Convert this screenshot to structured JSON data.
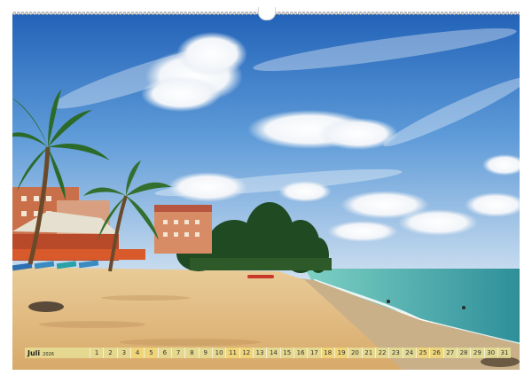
{
  "calendar": {
    "month": "Juli",
    "year": "2026",
    "days": [
      "1",
      "2",
      "3",
      "4",
      "5",
      "6",
      "7",
      "8",
      "9",
      "10",
      "11",
      "12",
      "13",
      "14",
      "15",
      "16",
      "17",
      "18",
      "19",
      "20",
      "21",
      "22",
      "23",
      "24",
      "25",
      "26",
      "27",
      "28",
      "29",
      "30",
      "31"
    ],
    "weekend_days": [
      "4",
      "5",
      "11",
      "12",
      "18",
      "19",
      "25",
      "26"
    ]
  },
  "photo": {
    "subject": "tropical-beach-icon",
    "colors": {
      "sky_top": "#2a6cc0",
      "sky_bottom": "#c9dcef",
      "sea": "#5bbfb3",
      "sand": "#e9c58e"
    }
  }
}
